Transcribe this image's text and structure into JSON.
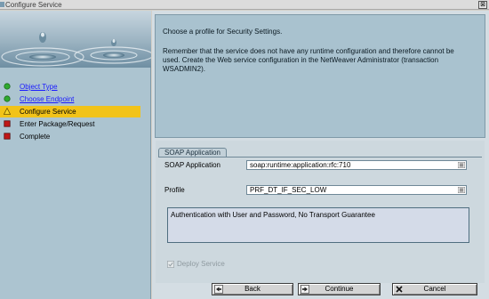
{
  "window": {
    "title": "Configure Service",
    "close_glyph": "⊠"
  },
  "wizard_steps": [
    {
      "label": "Object Type",
      "status": "done",
      "link": true
    },
    {
      "label": "Choose Endpoint",
      "status": "done",
      "link": true
    },
    {
      "label": "Configure Service",
      "status": "current",
      "link": false
    },
    {
      "label": "Enter Package/Request",
      "status": "pending",
      "link": false
    },
    {
      "label": "Complete",
      "status": "pending",
      "link": false
    }
  ],
  "info": {
    "line1": "Choose a profile for Security Settings.",
    "line2": "Remember that the service does not have any runtime configuration and therefore cannot be",
    "line3": "used. Create the Web service configuration in the NetWeaver Administrator (transaction",
    "line4": "WSADMIN2)."
  },
  "soap_group": {
    "tab_label": "SOAP Application",
    "soap_application_label": "SOAP Application",
    "soap_application_value": "soap:runtime:application:rfc:710",
    "profile_label": "Profile",
    "profile_value": "PRF_DT_IF_SEC_LOW",
    "profile_description": "Authentication with User and Password, No Transport Guarantee",
    "deploy_label": "Deploy Service",
    "deploy_checked": true,
    "deploy_enabled": false
  },
  "buttons": {
    "back": "Back",
    "continue": "Continue",
    "cancel": "Cancel"
  },
  "colors": {
    "current_step": "#f2c319",
    "done_icon": "#2faa2f",
    "pending_icon": "#c01818",
    "link": "#1a1aff",
    "info_panel": "#a9c2cf"
  },
  "icons": {
    "done": "green-circle-icon",
    "current": "yellow-triangle-icon",
    "pending": "red-square-icon"
  }
}
